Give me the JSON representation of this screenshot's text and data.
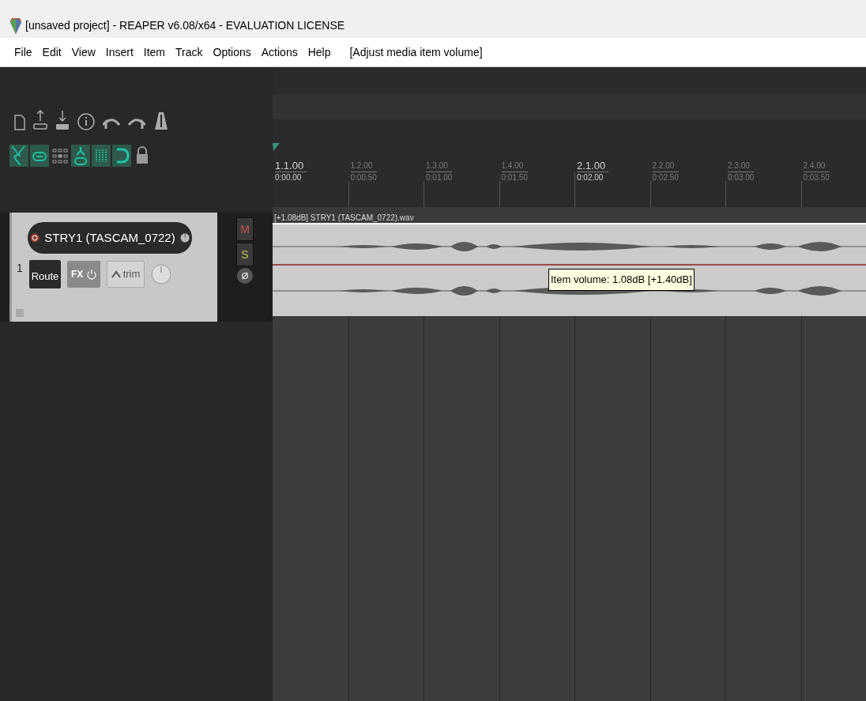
{
  "window": {
    "title": "[unsaved project] - REAPER v6.08/x64 - EVALUATION LICENSE"
  },
  "menu": [
    "File",
    "Edit",
    "View",
    "Insert",
    "Item",
    "Track",
    "Options",
    "Actions",
    "Help"
  ],
  "menu_status": "[Adjust media item volume]",
  "toggles": [
    {
      "kind": "ripple",
      "on": true
    },
    {
      "kind": "link",
      "on": true
    },
    {
      "kind": "grid",
      "on": false
    },
    {
      "kind": "group",
      "on": true
    },
    {
      "kind": "snapgrid",
      "on": true
    },
    {
      "kind": "snap",
      "on": true
    },
    {
      "kind": "lock",
      "on": false
    }
  ],
  "ruler": [
    {
      "beat": "1.1.00",
      "time": "0:00.00",
      "major": true
    },
    {
      "beat": "1.2.00",
      "time": "0:00.50",
      "major": false
    },
    {
      "beat": "1.3.00",
      "time": "0:01.00",
      "major": false
    },
    {
      "beat": "1.4.00",
      "time": "0:01.50",
      "major": false
    },
    {
      "beat": "2.1.00",
      "time": "0:02.00",
      "major": true
    },
    {
      "beat": "2.2.00",
      "time": "0:02.50",
      "major": false
    },
    {
      "beat": "2.3.00",
      "time": "0:03.00",
      "major": false
    },
    {
      "beat": "2.4.00",
      "time": "0:03.50",
      "major": false
    }
  ],
  "track": {
    "number": "1",
    "name": "STRY1 (TASCAM_0722)",
    "route": "Route",
    "fx": "FX",
    "trim": "trim",
    "mute": "M",
    "solo": "S",
    "phase": "Ø"
  },
  "item": {
    "label": "[+1.08dB] STRY1 (TASCAM_0722).wav"
  },
  "tooltip": "Item volume: 1.08dB [+1.40dB]"
}
